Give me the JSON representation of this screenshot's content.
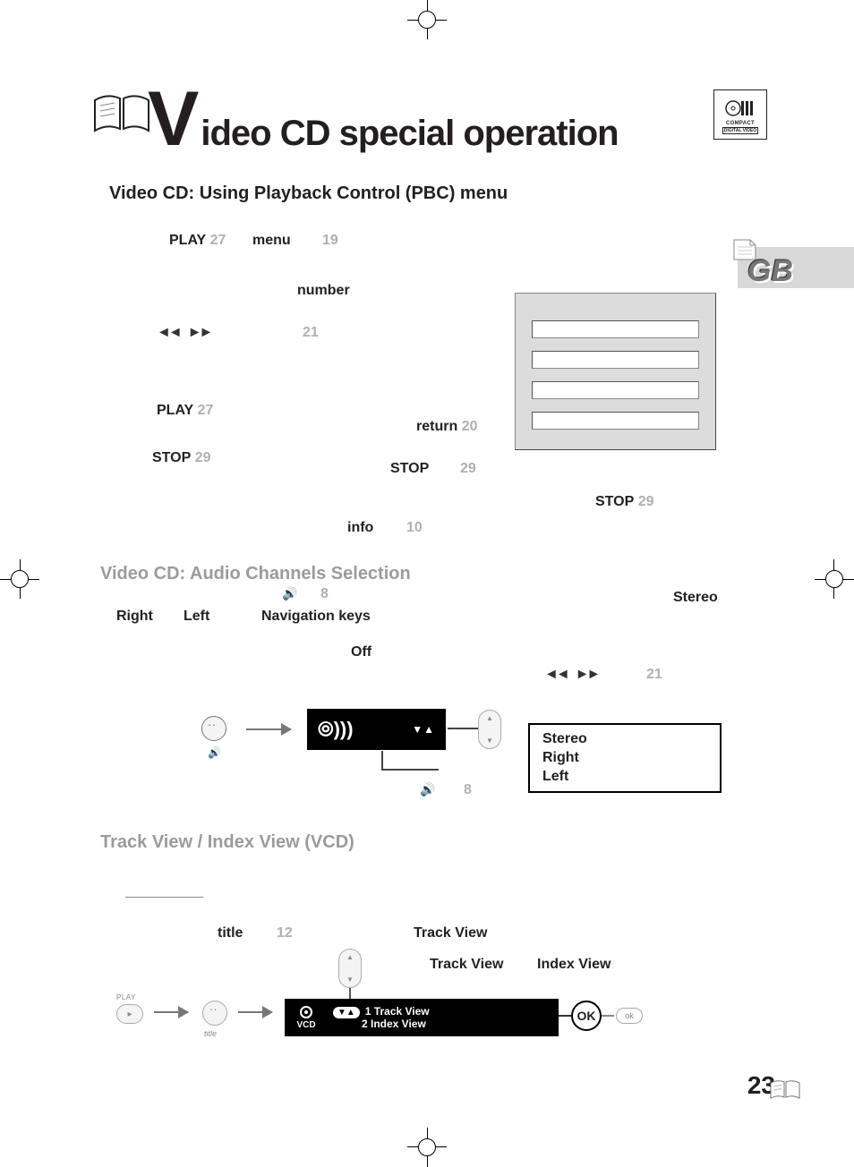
{
  "title": {
    "drop": "V",
    "rest": "ideo CD special operation"
  },
  "cd_logo": {
    "line1": "COMPACT",
    "line2": "DIGITAL VIDEO"
  },
  "gb": "GB",
  "section1": "Video CD: Using Playback Control (PBC) menu",
  "section2": "Video CD: Audio Channels Selection",
  "section3": "Track View / Index View (VCD)",
  "pbc": {
    "play1_label": "PLAY",
    "play1_num": "27",
    "menu_label": "menu",
    "menu_num": "19",
    "number_label": "number",
    "seek_num": "21",
    "seek_left": "◄◄",
    "seek_right": "►►",
    "play2_label": "PLAY",
    "play2_num": "27",
    "return_label": "return",
    "return_num": "20",
    "stop1_label": "STOP",
    "stop1_num": "29",
    "stop2_label": "STOP",
    "stop2_num": "29",
    "stop3_label": "STOP",
    "stop3_num": "29",
    "info_label": "info",
    "info_num": "10"
  },
  "audio": {
    "right": "Right",
    "left": "Left",
    "stereo": "Stereo",
    "nav_label": "Navigation keys",
    "off": "Off",
    "speaker_num_a": "8",
    "speaker_num_b": "8",
    "seek_num": "21",
    "seek_left": "◄◄",
    "seek_right": "►►",
    "options": {
      "a": "Stereo",
      "b": "Right",
      "c": "Left"
    },
    "osd_tri": "▼▲"
  },
  "trackview": {
    "title_label": "title",
    "title_num": "12",
    "trackview1": "Track View",
    "trackview2": "Track View",
    "indexview": "Index View",
    "osd_vcd": "VCD",
    "osd_key": "▼▲",
    "osd_line1": "1 Track View",
    "osd_line2": "2 Index View",
    "ok": "OK",
    "ok_small": "ok",
    "play_small": "PLAY",
    "play_tri": "▸",
    "title_small": "title"
  },
  "page_number": "23"
}
